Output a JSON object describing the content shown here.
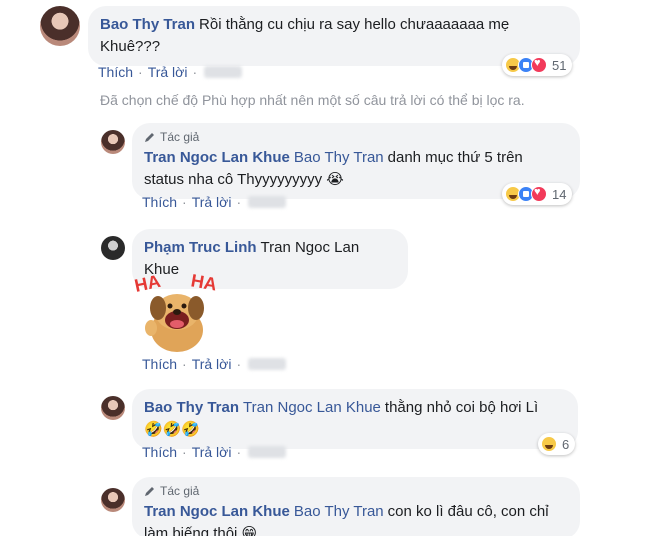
{
  "comments": [
    {
      "author": "Bao Thy Tran",
      "text_line1": "Rồi thằng cu chịu ra say hello chưaaaaaaa mẹ",
      "text_line2": "Khuê???",
      "like_label": "Thích",
      "reply_label": "Trả lời",
      "reaction_count": "51"
    },
    {
      "badge": "Tác giả",
      "author": "Tran Ngoc Lan Khue",
      "mention": "Bao Thy Tran",
      "text_line1": "danh mục thứ 5 trên",
      "text_line2": "status nha cô Thyyyyyyyyy 😭",
      "like_label": "Thích",
      "reply_label": "Trả lời",
      "reaction_count": "14"
    },
    {
      "author": "Phạm Truc Linh",
      "mention": "Tran Ngoc Lan Khue",
      "like_label": "Thích",
      "reply_label": "Trả lời",
      "sticker_text_left": "HA",
      "sticker_text_right": "HA"
    },
    {
      "author": "Bao Thy Tran",
      "mention": "Tran Ngoc Lan Khue",
      "text_line1": "thằng nhỏ coi bộ hơi Lì",
      "text_line2": "🤣🤣🤣",
      "like_label": "Thích",
      "reply_label": "Trả lời",
      "reaction_count": "6"
    },
    {
      "badge": "Tác giả",
      "author": "Tran Ngoc Lan Khue",
      "mention": "Bao Thy Tran",
      "text_line1": "con ko lì đâu cô, con chỉ",
      "text_line2": "làm biếng thôi 😁"
    }
  ],
  "filter_note": "Đã chọn chế độ Phù hợp nhất nên một số câu trả lời có thể bị lọc ra.",
  "separator": "·"
}
